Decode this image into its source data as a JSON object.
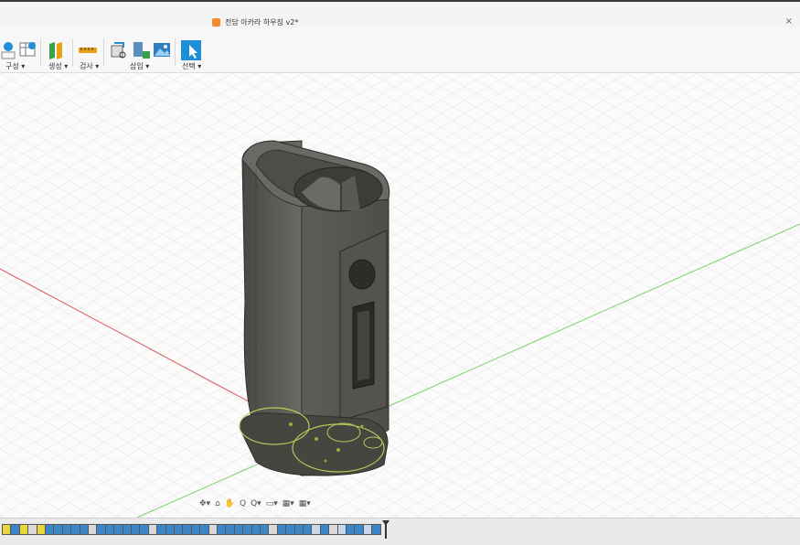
{
  "window": {
    "doc_title": "전담 아카라 하우징 v2*",
    "close_glyph": "×"
  },
  "toolbar": {
    "configure_label": "구성 ▾",
    "create_label": "생성 ▾",
    "inspect_label": "검사 ▾",
    "insert_label": "삽입 ▾",
    "select_label": "선택 ▾",
    "accent_color": "#1e8fd6"
  },
  "navbar": {
    "items": [
      "✥▾",
      "⌂",
      "✋",
      "Q",
      "Q▾",
      "▭▾",
      "▦▾",
      "▦▾"
    ]
  },
  "timeline": {
    "feature_count": 44
  },
  "model": {
    "body_color": "#5b5954",
    "grid_color": "#e2e2e2",
    "x_axis_color": "#e05a5a",
    "y_axis_color": "#7ccf6b"
  }
}
